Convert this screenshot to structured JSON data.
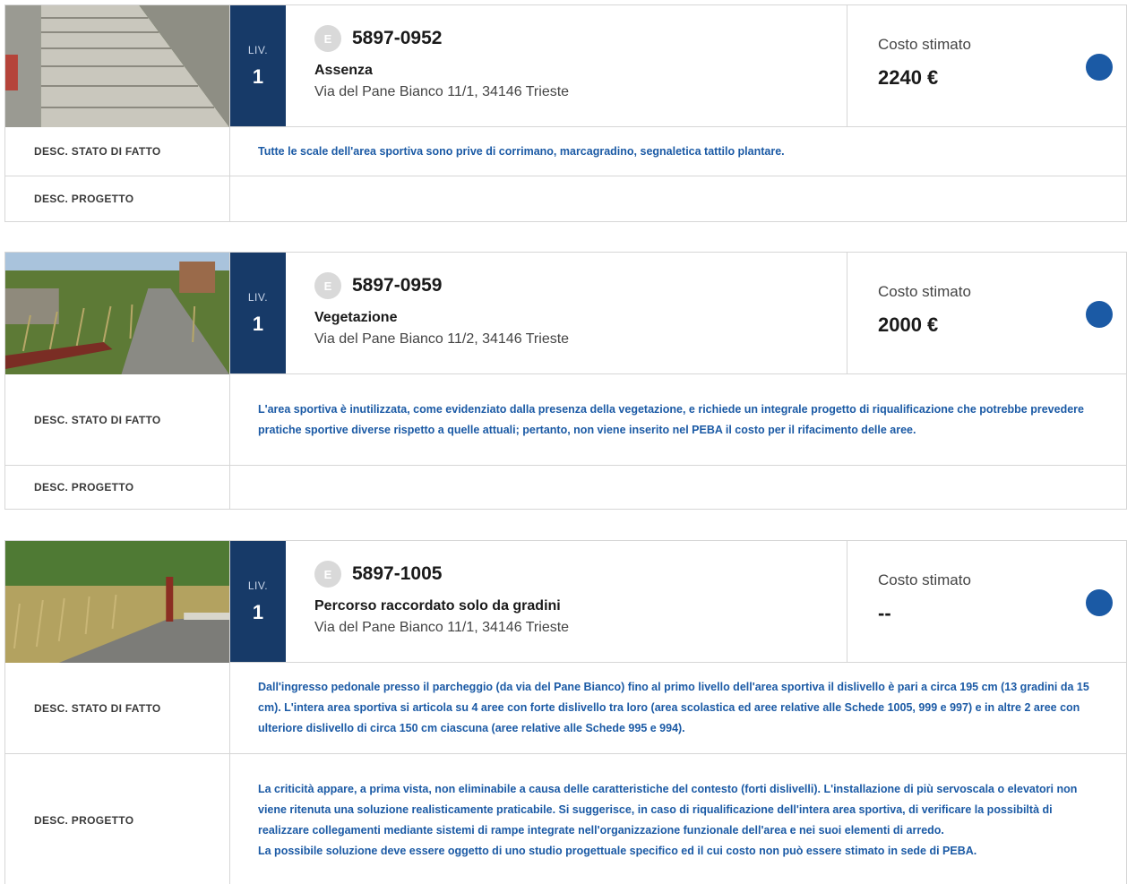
{
  "labels": {
    "level": "LIV.",
    "cost": "Costo stimato",
    "desc_state": "DESC. STATO DI FATTO",
    "desc_project": "DESC. PROGETTO",
    "badge": "E"
  },
  "colors": {
    "level_bg": "#173a68",
    "accent_text": "#1b5aa5",
    "status_dot": "#1b5aa5",
    "badge_bg": "#d9d9d9"
  },
  "cards": [
    {
      "photo": "photo-stairs",
      "level": "1",
      "code": "5897-0952",
      "title": "Assenza",
      "address": "Via del Pane Bianco 11/1, 34146 Trieste",
      "cost": "2240 €",
      "desc_state": "Tutte le scale dell'area sportiva sono prive di corrimano, marcagradino, segnaletica tattilo plantare.",
      "desc_project": ""
    },
    {
      "photo": "photo-vegetation",
      "level": "1",
      "code": "5897-0959",
      "title": "Vegetazione",
      "address": "Via del Pane Bianco 11/2, 34146 Trieste",
      "cost": "2000 €",
      "desc_state": "L'area sportiva è inutilizzata, come evidenziato dalla presenza della vegetazione, e richiede un integrale progetto di riqualificazione che potrebbe prevedere pratiche sportive diverse rispetto a quelle attuali; pertanto, non viene inserito nel PEBA il costo per il rifacimento delle aree.",
      "desc_project": ""
    },
    {
      "photo": "photo-path",
      "level": "1",
      "code": "5897-1005",
      "title": "Percorso raccordato solo da gradini",
      "address": "Via del Pane Bianco 11/1, 34146 Trieste",
      "cost": "--",
      "desc_state": "Dall'ingresso pedonale presso il parcheggio (da via del Pane Bianco) fino al primo livello dell'area sportiva il dislivello è pari a circa 195 cm (13 gradini da 15 cm). L'intera area sportiva si articola su 4 aree con forte dislivello tra loro (area scolastica ed aree relative alle Schede 1005, 999 e 997) e in altre 2 aree con ulteriore dislivello di circa 150 cm ciascuna (aree relative alle Schede 995 e 994).",
      "desc_project_1": "La criticità appare, a prima vista, non eliminabile a causa delle caratteristiche del contesto (forti dislivelli). L'installazione di più servoscala o elevatori non viene ritenuta una soluzione realisticamente praticabile. Si suggerisce, in caso di riqualificazione dell'intera area sportiva, di verificare la possibiltà di realizzare collegamenti mediante sistemi di rampe integrate nell'organizzazione funzionale dell'area e nei suoi elementi di arredo.",
      "desc_project_2": "La possibile soluzione deve essere oggetto di uno studio progettuale specifico ed il cui costo non può essere stimato in sede di PEBA."
    }
  ]
}
